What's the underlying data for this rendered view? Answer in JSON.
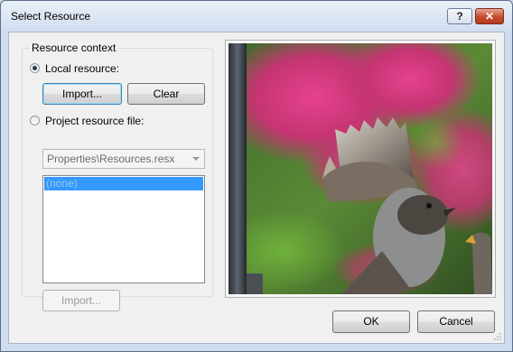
{
  "window": {
    "title": "Select Resource"
  },
  "titlebar": {
    "help_label": "?",
    "close_label": "✕"
  },
  "resource_context": {
    "legend": "Resource context",
    "local_resource_label": "Local resource:",
    "local_selected": true,
    "import_label": "Import...",
    "clear_label": "Clear",
    "project_file_label": "Project resource file:",
    "project_selected": false,
    "project_file_value": "Properties\\Resources.resx",
    "list_items": [
      "(none)"
    ],
    "project_import_label": "Import..."
  },
  "preview": {
    "image": "bird-spreading-wing-photo"
  },
  "footer": {
    "ok_label": "OK",
    "cancel_label": "Cancel"
  },
  "colors": {
    "selection": "#3399ff",
    "window_frame": "#cfdcef",
    "close_button": "#c64a2c"
  }
}
